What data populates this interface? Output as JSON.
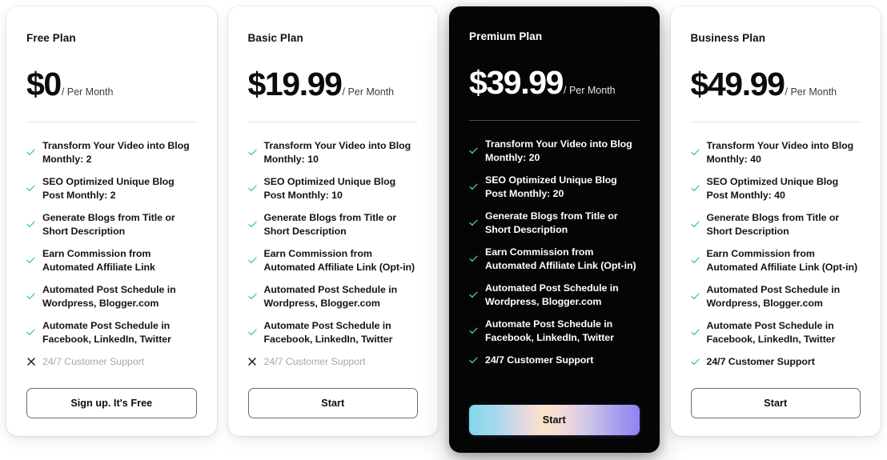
{
  "theme": {
    "page_background": "#ffffff",
    "card_background": "#ffffff",
    "featured_card_background": "#050505",
    "check_color": "#3fd38a",
    "cross_color": "#1a1a1a",
    "muted_text": "#a7a7ad",
    "gradient_from": "#7fd9ea",
    "gradient_mid": "#fbe3c8",
    "gradient_to": "#8f83f2"
  },
  "icons": {
    "check": "check-icon",
    "cross": "cross-icon"
  },
  "plans": [
    {
      "name": "Free Plan",
      "price": "$0",
      "period": "/ Per Month",
      "featured": false,
      "cta_label": "Sign up. It's Free",
      "features": [
        {
          "text": "Transform Your Video into Blog Monthly: 2",
          "included": true
        },
        {
          "text": "SEO Optimized Unique Blog Post Monthly: 2",
          "included": true
        },
        {
          "text": "Generate Blogs from Title or Short Description",
          "included": true
        },
        {
          "text": "Earn Commission from Automated Affiliate Link",
          "included": true
        },
        {
          "text": "Automated Post Schedule in Wordpress, Blogger.com",
          "included": true
        },
        {
          "text": "Automate Post Schedule in Facebook, LinkedIn, Twitter",
          "included": true
        },
        {
          "text": "24/7 Customer Support",
          "included": false
        }
      ]
    },
    {
      "name": "Basic Plan",
      "price": "$19.99",
      "period": "/ Per Month",
      "featured": false,
      "cta_label": "Start",
      "features": [
        {
          "text": "Transform Your Video into Blog Monthly: 10",
          "included": true
        },
        {
          "text": "SEO Optimized Unique Blog Post Monthly: 10",
          "included": true
        },
        {
          "text": "Generate Blogs from Title or Short Description",
          "included": true
        },
        {
          "text": "Earn Commission from Automated Affiliate Link (Opt-in)",
          "included": true
        },
        {
          "text": "Automated Post Schedule in Wordpress, Blogger.com",
          "included": true
        },
        {
          "text": "Automate Post Schedule in Facebook, LinkedIn, Twitter",
          "included": true
        },
        {
          "text": "24/7 Customer Support",
          "included": false
        }
      ]
    },
    {
      "name": "Premium Plan",
      "price": "$39.99",
      "period": "/ Per Month",
      "featured": true,
      "cta_label": "Start",
      "features": [
        {
          "text": "Transform Your Video into Blog Monthly: 20",
          "included": true
        },
        {
          "text": "SEO Optimized Unique Blog Post Monthly: 20",
          "included": true
        },
        {
          "text": "Generate Blogs from Title or Short Description",
          "included": true
        },
        {
          "text": "Earn Commission from Automated Affiliate Link (Opt-in)",
          "included": true
        },
        {
          "text": "Automated Post Schedule in Wordpress, Blogger.com",
          "included": true
        },
        {
          "text": "Automate Post Schedule in Facebook, LinkedIn, Twitter",
          "included": true
        },
        {
          "text": "24/7 Customer Support",
          "included": true
        }
      ]
    },
    {
      "name": "Business Plan",
      "price": "$49.99",
      "period": "/ Per Month",
      "featured": false,
      "cta_label": "Start",
      "features": [
        {
          "text": "Transform Your Video into Blog Monthly: 40",
          "included": true
        },
        {
          "text": "SEO Optimized Unique Blog Post Monthly: 40",
          "included": true
        },
        {
          "text": "Generate Blogs from Title or Short Description",
          "included": true
        },
        {
          "text": "Earn Commission from Automated Affiliate Link (Opt-in)",
          "included": true
        },
        {
          "text": "Automated Post Schedule in Wordpress, Blogger.com",
          "included": true
        },
        {
          "text": "Automate Post Schedule in Facebook, LinkedIn, Twitter",
          "included": true
        },
        {
          "text": "24/7 Customer Support",
          "included": true
        }
      ]
    }
  ]
}
